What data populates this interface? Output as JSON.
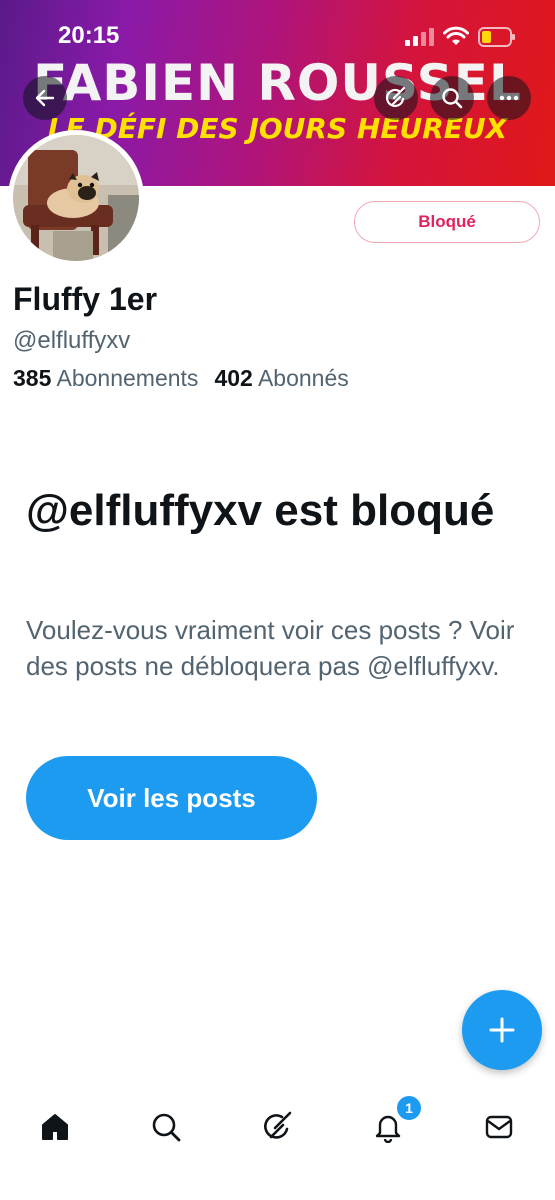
{
  "status_bar": {
    "time": "20:15",
    "icons": [
      "signal-icon",
      "wifi-icon",
      "battery-icon"
    ]
  },
  "banner": {
    "line1": "FABIEN ROUSSEL",
    "line2": "LE DÉFI DES JOURS HEUREUX"
  },
  "header_buttons": [
    "back-arrow-icon",
    "grok-icon",
    "search-icon",
    "more-icon"
  ],
  "profile": {
    "display_name": "Fluffy 1er",
    "handle": "@elfluffyxv",
    "following_count": "385",
    "following_label": "Abonnements",
    "followers_count": "402",
    "followers_label": "Abonnés",
    "blocked_button_label": "Bloqué"
  },
  "blocked_notice": {
    "title": "@elfluffyxv est bloqué",
    "subtitle": "Voulez-vous vraiment voir ces posts ? Voir des posts ne débloquera pas @elfluffyxv.",
    "view_posts_label": "Voir les posts"
  },
  "fab": {
    "icon": "plus-icon"
  },
  "tab_bar": {
    "items": [
      "home-icon",
      "search-icon",
      "grok-icon",
      "notifications-icon",
      "messages-icon"
    ],
    "notification_badge": "1"
  },
  "colors": {
    "accent": "#1d9bf0",
    "blocked_red": "#e0245e",
    "secondary_text": "#536471",
    "primary_text": "#0f1419"
  }
}
